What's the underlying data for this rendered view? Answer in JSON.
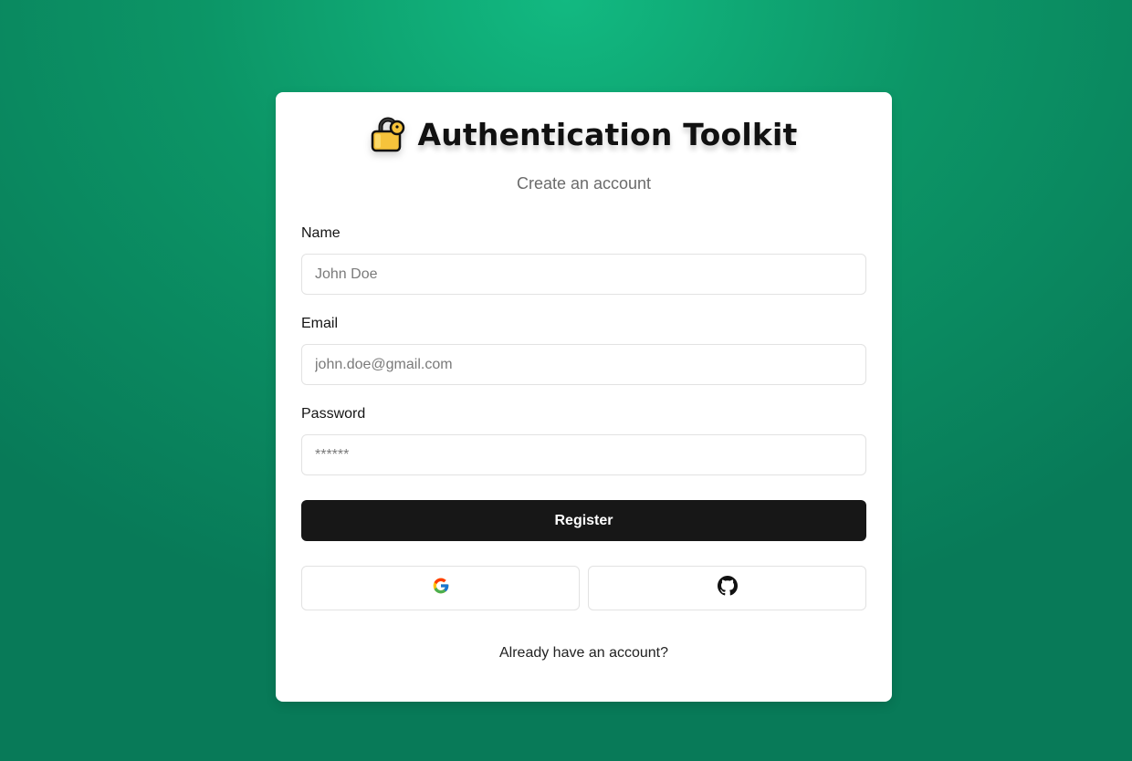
{
  "header": {
    "icon": "lock-icon",
    "title": "Authentication Toolkit",
    "subtitle": "Create an account"
  },
  "form": {
    "name": {
      "label": "Name",
      "placeholder": "John Doe",
      "value": ""
    },
    "email": {
      "label": "Email",
      "placeholder": "john.doe@gmail.com",
      "value": ""
    },
    "password": {
      "label": "Password",
      "placeholder": "******",
      "value": ""
    },
    "submit_label": "Register"
  },
  "social": [
    {
      "provider": "google",
      "icon": "google-icon"
    },
    {
      "provider": "github",
      "icon": "github-icon"
    }
  ],
  "footer": {
    "link_text": "Already have an account?"
  },
  "colors": {
    "background_top": "#12b981",
    "background_bottom": "#087a58",
    "button": "#171717",
    "lock_body": "#f6c33b"
  }
}
